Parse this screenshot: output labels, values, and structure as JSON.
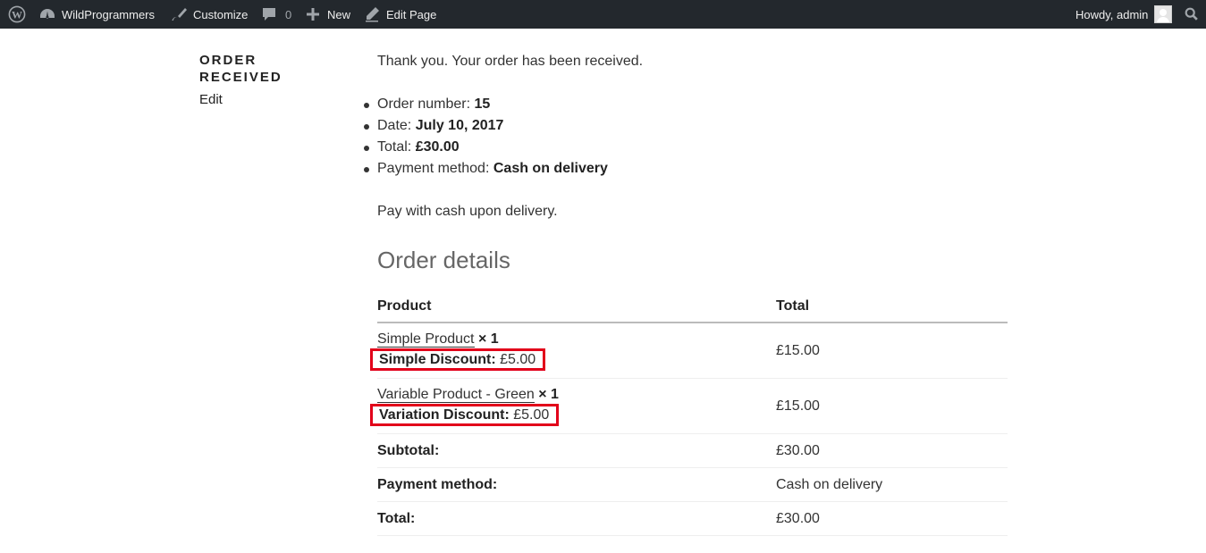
{
  "adminbar": {
    "site_name": "WildProgrammers",
    "customize": "Customize",
    "comments_count": "0",
    "new": "New",
    "edit_page": "Edit Page",
    "howdy": "Howdy, admin"
  },
  "sidebar": {
    "title": "ORDER RECEIVED",
    "edit": "Edit"
  },
  "main": {
    "thankyou": "Thank you. Your order has been received.",
    "overview": [
      {
        "label": "Order number:",
        "value": "15"
      },
      {
        "label": "Date:",
        "value": "July 10, 2017"
      },
      {
        "label": "Total:",
        "value": "£30.00"
      },
      {
        "label": "Payment method:",
        "value": "Cash on delivery"
      }
    ],
    "pay_note": "Pay with cash upon delivery.",
    "details_title": "Order details",
    "table": {
      "headers": {
        "product": "Product",
        "total": "Total"
      },
      "items": [
        {
          "name": "Simple Product",
          "qty": "× 1",
          "meta_label": "Simple Discount:",
          "meta_value": "£5.00",
          "total": "£15.00"
        },
        {
          "name": "Variable Product - Green",
          "qty": "× 1",
          "meta_label": "Variation Discount:",
          "meta_value": "£5.00",
          "total": "£15.00"
        }
      ],
      "footer": [
        {
          "label": "Subtotal:",
          "value": "£30.00"
        },
        {
          "label": "Payment method:",
          "value": "Cash on delivery"
        },
        {
          "label": "Total:",
          "value": "£30.00"
        }
      ]
    }
  },
  "colors": {
    "adminbar_bg": "#23282d",
    "highlight_box": "#e2001a",
    "text": "#333333"
  }
}
